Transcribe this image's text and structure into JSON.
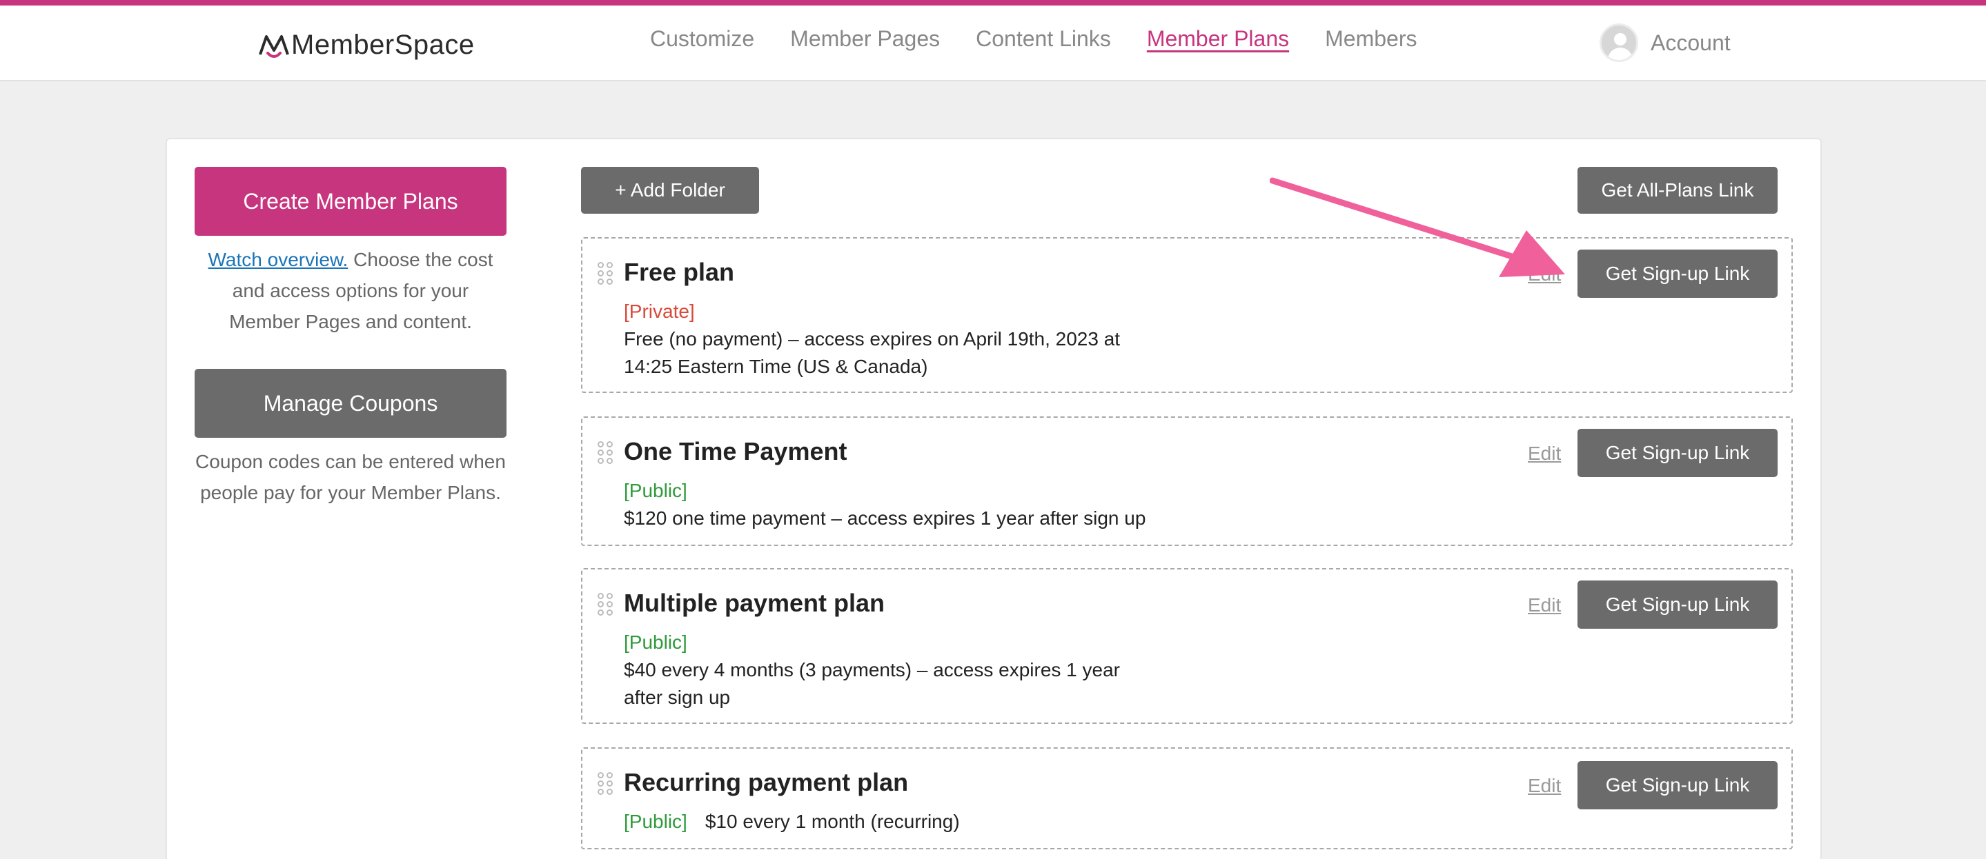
{
  "brand": {
    "name": "MemberSpace",
    "accent": "#c7357f"
  },
  "nav": {
    "items": [
      "Customize",
      "Member Pages",
      "Content Links",
      "Member Plans",
      "Members"
    ],
    "active": "Member Plans"
  },
  "account": {
    "label": "Account",
    "icon": "user-avatar-icon"
  },
  "sidebar": {
    "create_label": "Create Member Plans",
    "watch_link": "Watch overview.",
    "create_desc": "Choose the cost and access options for your Member Pages and content.",
    "manage_label": "Manage Coupons",
    "manage_desc": "Coupon codes can be entered when people pay for your Member Plans."
  },
  "toolbar": {
    "add_folder_label": "+ Add Folder",
    "all_plans_label": "Get All-Plans Link"
  },
  "plans": [
    {
      "title": "Free plan",
      "visibility": "[Private]",
      "details": "Free (no payment) – access expires on April 19th, 2023 at 14:25 Eastern Time (US & Canada)",
      "edit_label": "Edit",
      "signup_label": "Get Sign-up Link"
    },
    {
      "title": "One Time Payment",
      "visibility": "[Public]",
      "details": "$120 one time payment – access expires 1 year after sign up",
      "edit_label": "Edit",
      "signup_label": "Get Sign-up Link"
    },
    {
      "title": "Multiple payment plan",
      "visibility": "[Public]",
      "details": "$40 every 4 months (3 payments) – access expires 1 year after sign up",
      "edit_label": "Edit",
      "signup_label": "Get Sign-up Link"
    },
    {
      "title": "Recurring payment plan",
      "visibility": "[Public]",
      "details": "$10 every 1 month (recurring)",
      "edit_label": "Edit",
      "signup_label": "Get Sign-up Link"
    }
  ],
  "colors": {
    "private": "#d84a3a",
    "public": "#2f9a3a",
    "button_dark": "#6b6b6b",
    "annotation_arrow": "#f0609a"
  }
}
